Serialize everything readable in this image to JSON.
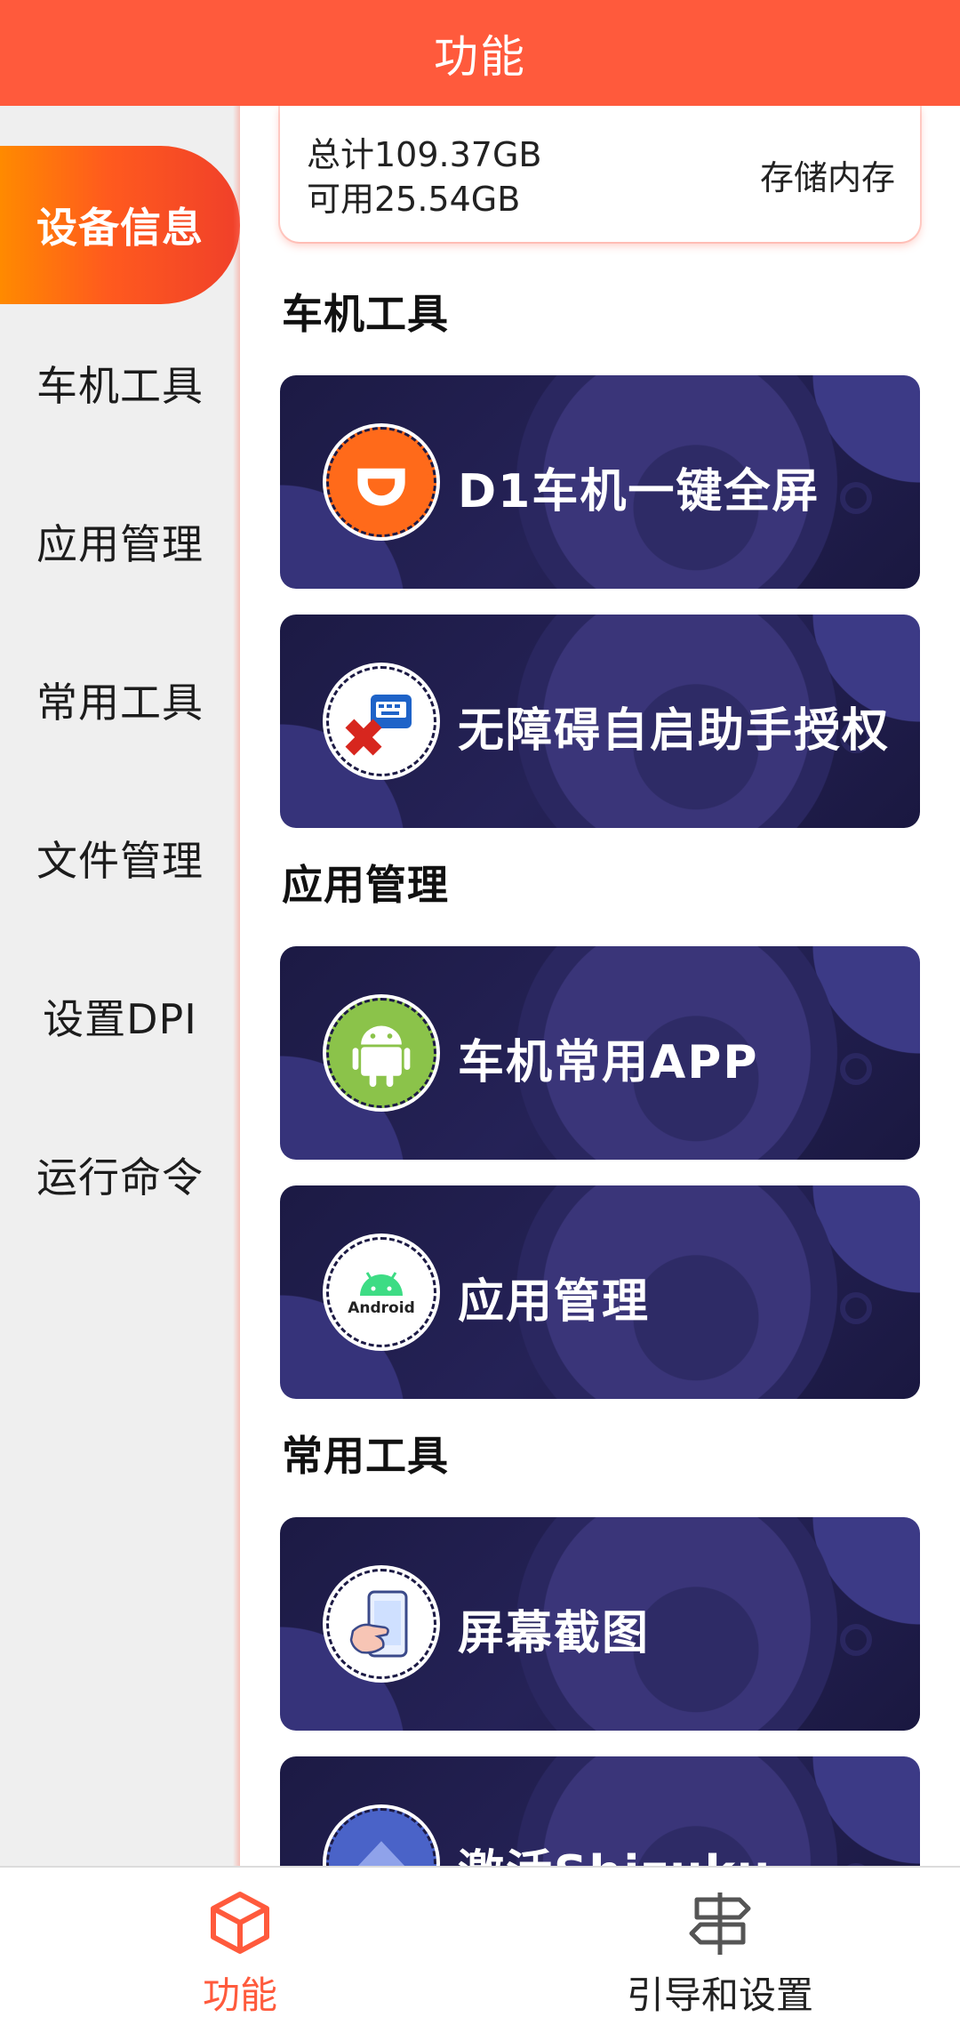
{
  "header": {
    "title": "功能"
  },
  "sidebar": {
    "items": [
      {
        "label": "设备信息",
        "active": true
      },
      {
        "label": "车机工具",
        "active": false
      },
      {
        "label": "应用管理",
        "active": false
      },
      {
        "label": "常用工具",
        "active": false
      },
      {
        "label": "文件管理",
        "active": false
      },
      {
        "label": "设置DPI",
        "active": false
      },
      {
        "label": "运行命令",
        "active": false
      }
    ]
  },
  "storage": {
    "total": "总计109.37GB",
    "available": "可用25.54GB",
    "kind": "存储内存"
  },
  "sections": [
    {
      "title": "车机工具"
    },
    {
      "title": "应用管理"
    },
    {
      "title": "常用工具"
    }
  ],
  "tools": [
    {
      "label": "D1车机一键全屏",
      "icon": "didi-icon"
    },
    {
      "label": "无障碍自启助手授权",
      "icon": "accessibility-app-icon"
    },
    {
      "label": "车机常用APP",
      "icon": "android-robot-icon"
    },
    {
      "label": "应用管理",
      "icon": "android-logo-icon",
      "icon_text": "Android"
    },
    {
      "label": "屏幕截图",
      "icon": "screenshot-hand-icon"
    },
    {
      "label": "激活Shizuku",
      "icon": "shizuku-icon"
    }
  ],
  "bottom_nav": {
    "items": [
      {
        "label": "功能",
        "icon": "cube-icon",
        "active": true
      },
      {
        "label": "引导和设置",
        "icon": "signpost-icon",
        "active": false
      }
    ]
  },
  "colors": {
    "primary": "#ff5a3c",
    "sidebar_bg": "#efefef",
    "card_bg": "#252257"
  }
}
